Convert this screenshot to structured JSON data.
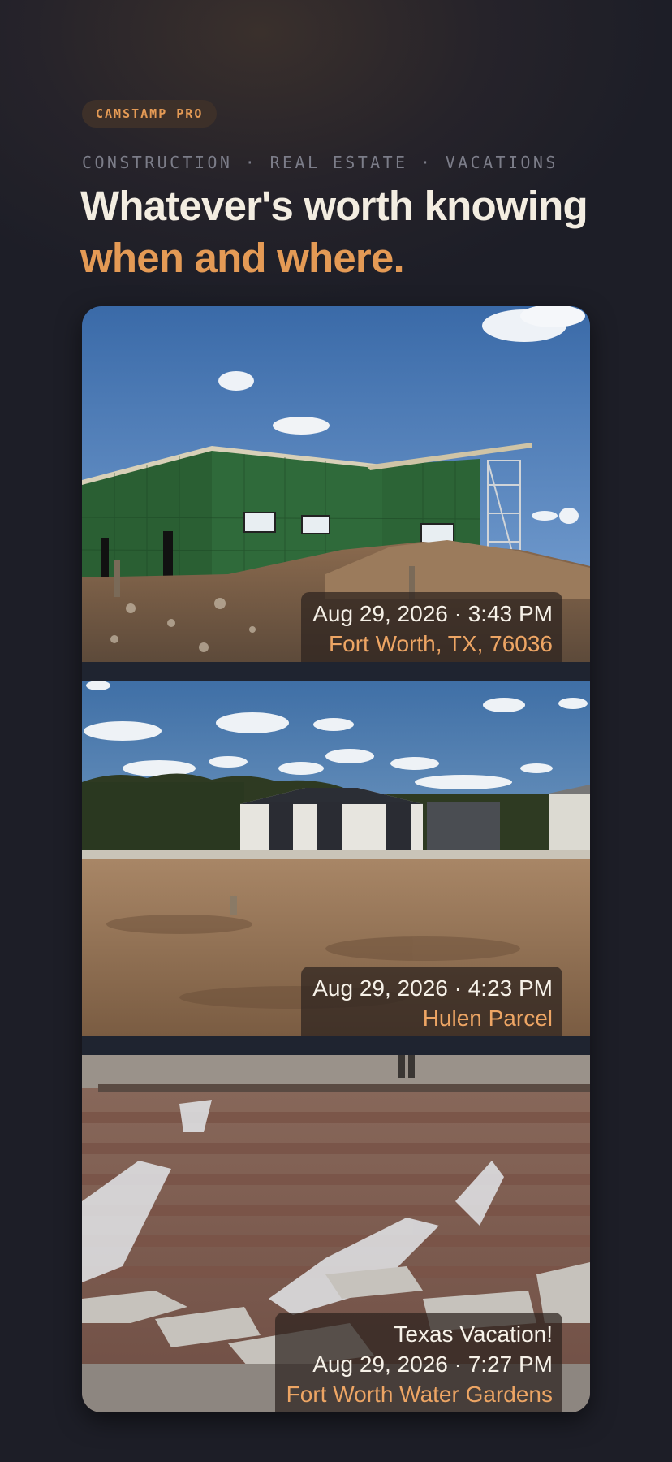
{
  "badge": "CAMSTAMP PRO",
  "tagline": "CONSTRUCTION · REAL ESTATE · VACATIONS",
  "headline": {
    "line1": "Whatever's worth knowing",
    "line2": "when and where."
  },
  "photos": [
    {
      "title": "",
      "datetime": "Aug 29, 2026 · 3:43 PM",
      "location": "Fort Worth, TX, 76036"
    },
    {
      "title": "",
      "datetime": "Aug 29, 2026 · 4:23 PM",
      "location": "Hulen Parcel"
    },
    {
      "title": "Texas Vacation!",
      "datetime": "Aug 29, 2026 · 7:27 PM",
      "location": "Fort Worth Water Gardens"
    }
  ],
  "colors": {
    "accent": "#e49a55",
    "background": "#1d1e27",
    "headline": "#f3ede1",
    "badge_bg": "#3d3029"
  }
}
